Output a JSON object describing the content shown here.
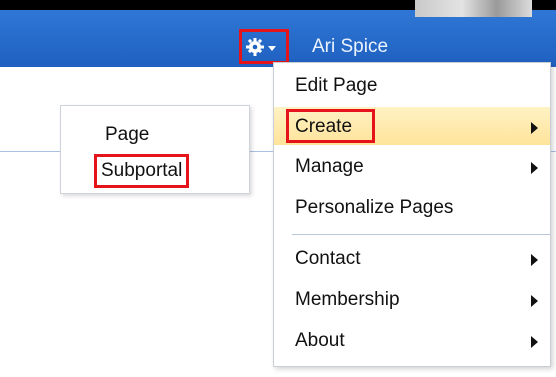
{
  "header": {
    "user_name": "Ari Spice"
  },
  "submenu": {
    "items": [
      "Page",
      "Subportal"
    ]
  },
  "menu": {
    "items": [
      {
        "label": "Edit Page",
        "has_submenu": false
      },
      {
        "label": "Create",
        "has_submenu": true,
        "selected": true
      },
      {
        "label": "Manage",
        "has_submenu": true
      },
      {
        "label": "Personalize Pages",
        "has_submenu": false
      },
      {
        "label": "Contact",
        "has_submenu": true
      },
      {
        "label": "Membership",
        "has_submenu": true
      },
      {
        "label": "About",
        "has_submenu": true
      }
    ]
  },
  "colors": {
    "header_blue": "#2f77d6",
    "highlight": "#ffe39a",
    "annotation_red": "#e5141a"
  },
  "icons": [
    "gear-icon",
    "chevron-down-icon",
    "submenu-arrow-icon"
  ]
}
